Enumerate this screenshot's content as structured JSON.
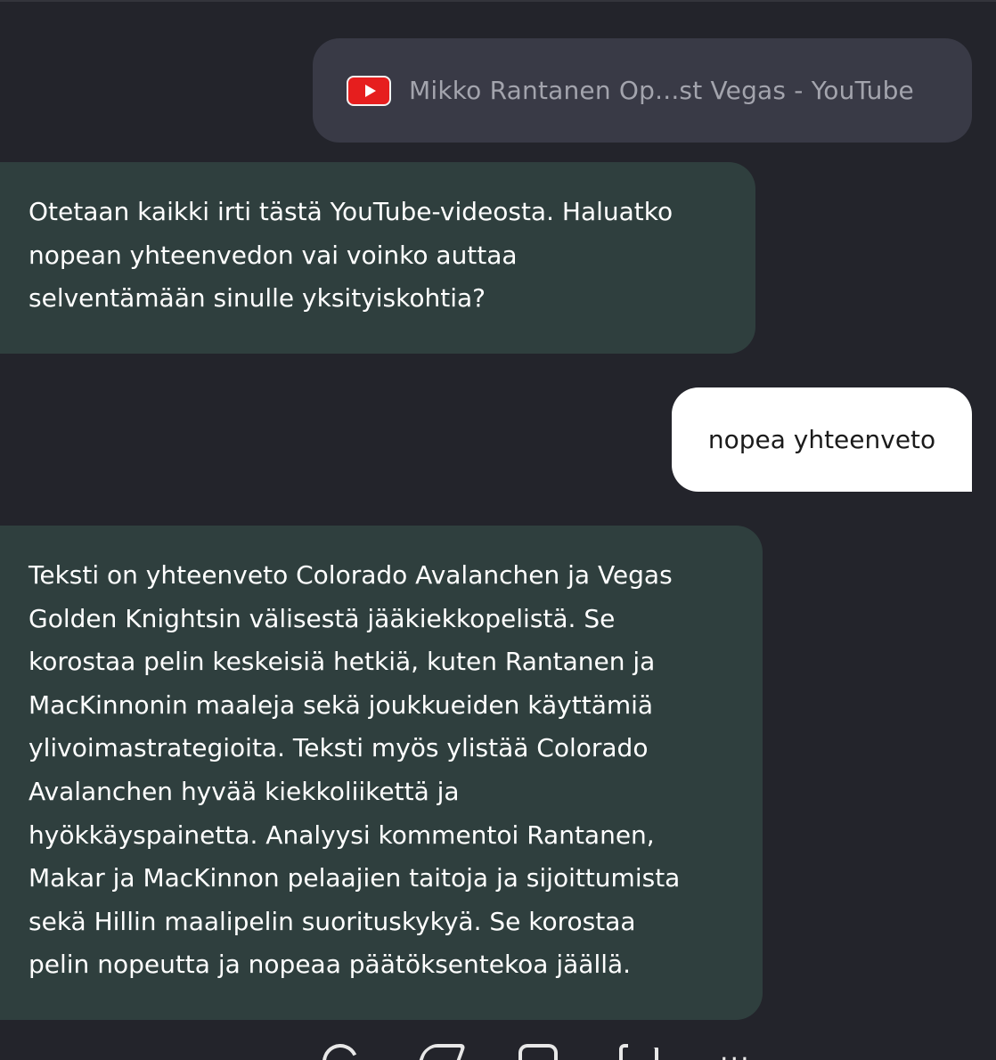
{
  "link_card": {
    "icon": "youtube-icon",
    "title": "Mikko Rantanen Op...st Vegas - YouTube"
  },
  "messages": [
    {
      "role": "assistant",
      "lines": [
        "Otetaan kaikki irti tästä YouTube-videosta. Haluatko",
        "nopean yhteenvedon vai voinko auttaa",
        "selventämään sinulle yksityiskohtia?"
      ]
    },
    {
      "role": "user",
      "text": "nopea yhteenveto"
    },
    {
      "role": "assistant",
      "lines": [
        "Teksti on yhteenveto Colorado Avalanchen ja Vegas",
        "Golden Knightsin välisestä jääkiekkopelistä. Se",
        "korostaa pelin keskeisiä hetkiä, kuten Rantanen ja",
        "MacKinnonin maaleja sekä joukkueiden käyttämiä",
        "ylivoimastrategioita. Teksti myös ylistää Colorado",
        "Avalanchen hyvää kiekkoliikettä ja",
        "hyökkäyspainetta. Analyysi kommentoi Rantanen,",
        "Makar ja MacKinnon pelaajien taitoja ja sijoittumista",
        "sekä Hillin maalipelin suorituskykyä. Se korostaa",
        "pelin nopeutta ja nopeaa päätöksentekoa jäällä."
      ]
    }
  ],
  "action_icons": [
    "regenerate-icon",
    "thumbs-up-icon",
    "bookmark-icon",
    "copy-icon",
    "more-icon"
  ],
  "colors": {
    "background": "#23242b",
    "link_bubble": "#393a46",
    "assistant_bubble": "#2f3f3e",
    "user_bubble": "#ffffff",
    "youtube_red": "#e61e1e"
  }
}
